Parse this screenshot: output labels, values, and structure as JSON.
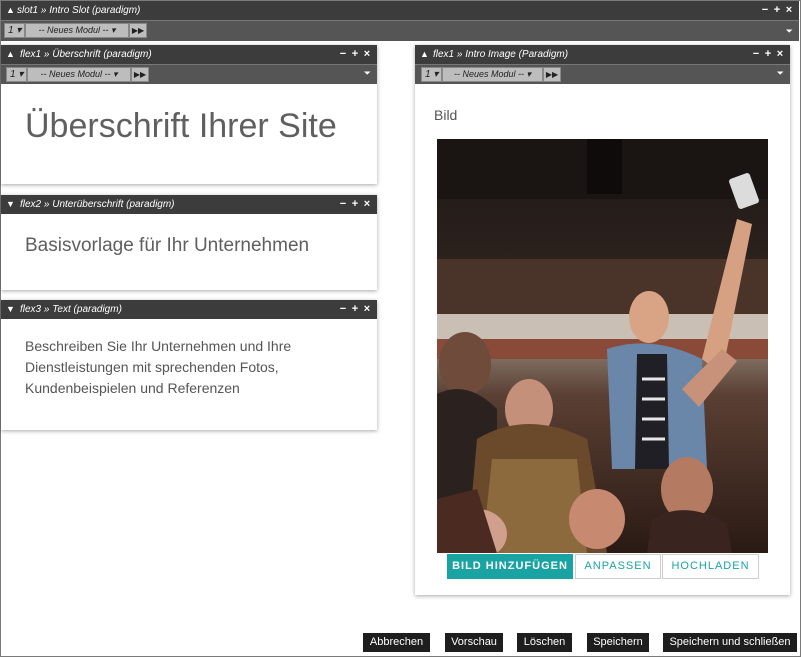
{
  "slot": {
    "title": "slot1 » Intro Slot (paradigm)",
    "number": "1",
    "module_select": "-- Neues Modul --"
  },
  "panels": {
    "heading": {
      "title": "flex1 » Überschrift (paradigm)",
      "number": "1",
      "module_select": "-- Neues Modul --",
      "text": "Überschrift Ihrer Site"
    },
    "subheading": {
      "title": "flex2 » Unterüberschrift (paradigm)",
      "text": "Basisvorlage für Ihr Unternehmen"
    },
    "text": {
      "title": "flex3 » Text (paradigm)",
      "text": "Beschreiben Sie Ihr Unternehmen und Ihre Dienstleistungen mit sprechenden Fotos, Kundenbeispielen und Referenzen"
    },
    "image": {
      "title": "flex1 » Intro Image (Paradigm)",
      "number": "1",
      "module_select": "-- Neues Modul --",
      "label": "Bild",
      "buttons": {
        "add": "BILD HINZUFÜGEN",
        "adjust": "ANPASSEN",
        "upload": "HOCHLADEN"
      }
    }
  },
  "controls": {
    "minimize": "−",
    "add": "+",
    "close": "×"
  },
  "footer": {
    "cancel": "Abbrechen",
    "preview": "Vorschau",
    "delete": "Löschen",
    "save": "Speichern",
    "save_close": "Speichern und schließen"
  },
  "colors": {
    "accent": "#1aa3a3",
    "bar": "#3c3c3c",
    "footer_button": "#1e1e1e"
  }
}
